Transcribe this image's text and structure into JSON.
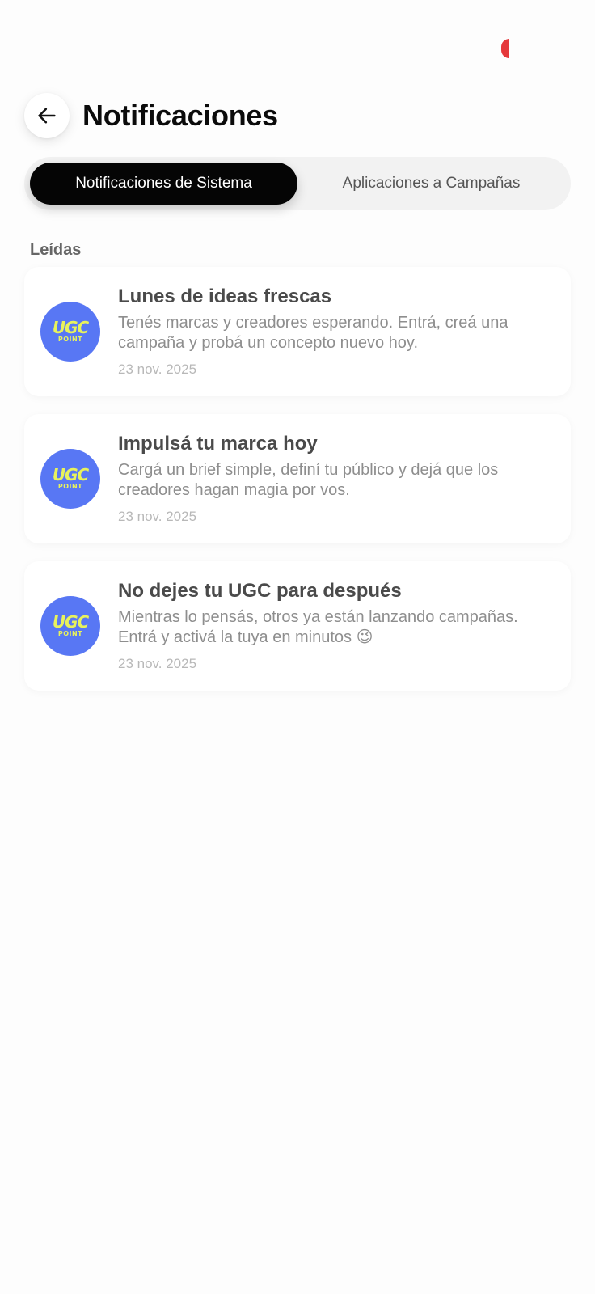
{
  "header": {
    "title": "Notificaciones"
  },
  "tabs": [
    {
      "label": "Notificaciones de Sistema",
      "active": true
    },
    {
      "label": "Aplicaciones a Campañas",
      "active": false
    }
  ],
  "section": {
    "label": "Leídas"
  },
  "brand": {
    "avatar_line1": "UGC",
    "avatar_line2": "POINT",
    "avatar_bg": "#5877f4",
    "avatar_fg": "#e8f25c"
  },
  "notifications": [
    {
      "title": "Lunes de ideas frescas",
      "text": "Tenés marcas y creadores esperando. Entrá, creá una campaña y probá un concepto nuevo hoy.",
      "date": "23 nov. 2025"
    },
    {
      "title": "Impulsá tu marca hoy",
      "text": "Cargá un brief simple, definí tu público y dejá que los creadores hagan magia por vos.",
      "date": "23 nov. 2025"
    },
    {
      "title": "No dejes tu UGC para después",
      "text": "Mientras lo pensás, otros ya están lanzando campañas. Entrá y activá la tuya en minutos 😉",
      "date": "23 nov. 2025"
    }
  ]
}
